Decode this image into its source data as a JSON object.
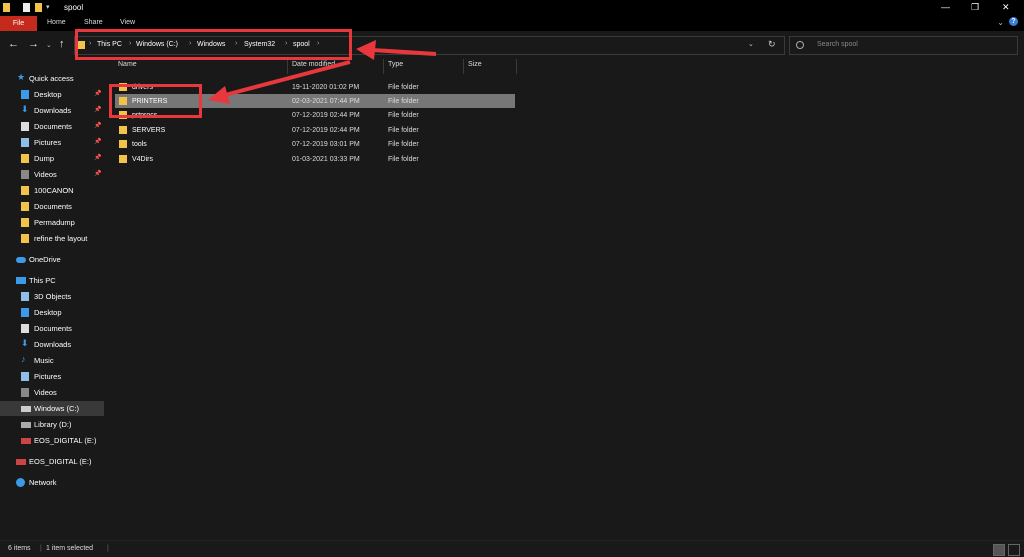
{
  "window": {
    "title": "spool"
  },
  "ribbon": {
    "tabs": [
      "File",
      "Home",
      "Share",
      "View"
    ]
  },
  "address": {
    "crumbs": [
      "This PC",
      "Windows (C:)",
      "Windows",
      "System32",
      "spool"
    ]
  },
  "search": {
    "placeholder": "Search spool"
  },
  "columns": {
    "name": "Name",
    "date": "Date modified",
    "type": "Type",
    "size": "Size"
  },
  "rows": [
    {
      "name": "drivers",
      "date": "19-11-2020 01:02 PM",
      "type": "File folder"
    },
    {
      "name": "PRINTERS",
      "date": "02-03-2021 07:44 PM",
      "type": "File folder"
    },
    {
      "name": "prtprocs",
      "date": "07-12-2019 02:44 PM",
      "type": "File folder"
    },
    {
      "name": "SERVERS",
      "date": "07-12-2019 02:44 PM",
      "type": "File folder"
    },
    {
      "name": "tools",
      "date": "07-12-2019 03:01 PM",
      "type": "File folder"
    },
    {
      "name": "V4Dirs",
      "date": "01-03-2021 03:33 PM",
      "type": "File folder"
    }
  ],
  "sidebar": {
    "quick_access": "Quick access",
    "quick_items": [
      "Desktop",
      "Downloads",
      "Documents",
      "Pictures",
      "Dump",
      "Videos",
      "100CANON",
      "Documents",
      "Permadump",
      "refine the layout"
    ],
    "onedrive": "OneDrive",
    "this_pc": "This PC",
    "pc_items": [
      "3D Objects",
      "Desktop",
      "Documents",
      "Downloads",
      "Music",
      "Pictures",
      "Videos",
      "Windows (C:)",
      "Library (D:)",
      "EOS_DIGITAL (E:)"
    ],
    "eos": "EOS_DIGITAL (E:)",
    "network": "Network"
  },
  "status": {
    "count": "6 items",
    "selected": "1 item selected"
  },
  "colors": {
    "background": "#191919",
    "accent_red": "#e8383d",
    "folder": "#f1c34b",
    "file_tab": "#c42b1c",
    "selection": "#777777"
  }
}
